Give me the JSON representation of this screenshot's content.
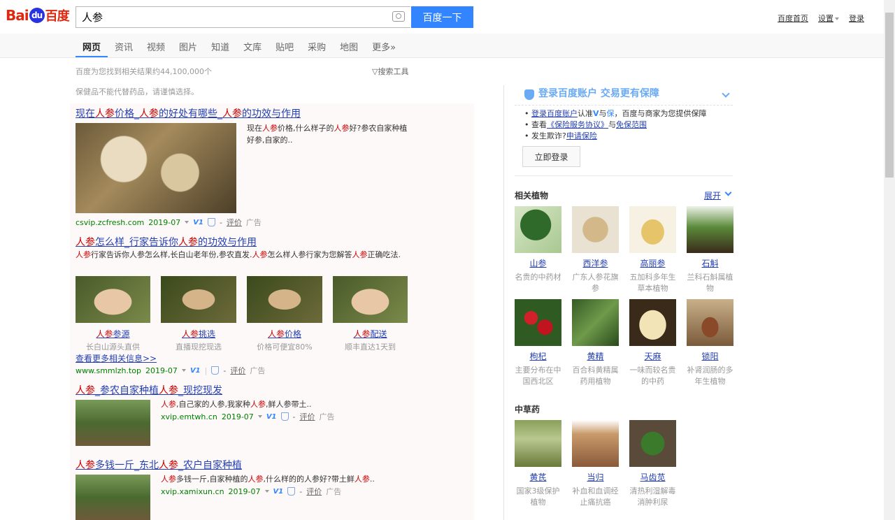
{
  "header": {
    "logo_bai": "Bai",
    "logo_du": "du",
    "logo_cn": "百度",
    "search_value": "人参",
    "search_button": "百度一下",
    "links": [
      "百度首页",
      "设置",
      "登录"
    ]
  },
  "tabs": [
    "网页",
    "资讯",
    "视频",
    "图片",
    "知道",
    "文库",
    "贴吧",
    "采购",
    "地图",
    "更多»"
  ],
  "result_count": "百度为您找到相关结果约44,100,000个",
  "search_tools": "搜索工具",
  "notice": "保健品不能代替药品，请谨慎选择。",
  "results": [
    {
      "title_parts": [
        [
          "现在",
          ""
        ],
        [
          "人参",
          "hl"
        ],
        [
          "价格_",
          ""
        ],
        [
          "人参",
          "hl"
        ],
        [
          "的好处有哪些_",
          ""
        ],
        [
          "人参",
          "hl"
        ],
        [
          "的功效与作用",
          ""
        ]
      ],
      "desc_parts": [
        [
          "现在",
          ""
        ],
        [
          "人参",
          "hl"
        ],
        [
          "价格,什么样子的",
          ""
        ],
        [
          "人参",
          "hl"
        ],
        [
          "好?参农自家种植好参,自家的..",
          ""
        ]
      ],
      "url": "csvip.zcfresh.com",
      "date": "2019-07",
      "review": "评价",
      "ad": "广告"
    },
    {
      "title_parts": [
        [
          "人参",
          "hl"
        ],
        [
          "怎么样_行家告诉你",
          ""
        ],
        [
          "人参",
          "hl"
        ],
        [
          "的功效与作用",
          ""
        ]
      ],
      "desc_parts": [
        [
          "人参",
          "hl"
        ],
        [
          "行家告诉你人参怎么样,长白山老年份,参农直发.",
          ""
        ],
        [
          "人参",
          "hl"
        ],
        [
          "怎么样人参行家为您解答",
          ""
        ],
        [
          "人参",
          "hl"
        ],
        [
          "正确吃法.",
          ""
        ]
      ],
      "sublinks": [
        {
          "title_hl": "人参",
          "title": "参源",
          "desc": "长白山源头直供"
        },
        {
          "title_hl": "人参",
          "title": "挑选",
          "desc": "直播现挖现选"
        },
        {
          "title_hl": "人参",
          "title": "价格",
          "desc": "价格可便宜80%"
        },
        {
          "title_hl": "人参",
          "title": "配送",
          "desc": "顺丰直达1天到"
        }
      ],
      "more": "查看更多相关信息>>",
      "url": "www.smmlzh.top",
      "date": "2019-07",
      "review": "评价",
      "ad": "广告"
    },
    {
      "title_parts": [
        [
          "人参",
          "hl"
        ],
        [
          "_参农自家种植",
          ""
        ],
        [
          "人参",
          "hl"
        ],
        [
          "_现挖现发",
          ""
        ]
      ],
      "desc_parts": [
        [
          "人参",
          "hl"
        ],
        [
          ",自己家的人参,我家种",
          ""
        ],
        [
          "人参",
          "hl"
        ],
        [
          ",鲜人参带土..",
          ""
        ]
      ],
      "url": "xvip.emtwh.cn",
      "date": "2019-07",
      "review": "评价",
      "ad": "广告"
    },
    {
      "title_parts": [
        [
          "人参",
          "hl"
        ],
        [
          "多钱一斤_东北",
          ""
        ],
        [
          "人参",
          "hl"
        ],
        [
          "_农户自家种植",
          ""
        ]
      ],
      "desc_parts": [
        [
          "人参",
          "hl"
        ],
        [
          "多钱一斤,自家种植的",
          ""
        ],
        [
          "人参",
          "hl"
        ],
        [
          ",什么样的的人参好?带土鲜",
          ""
        ],
        [
          "人参",
          "hl"
        ],
        [
          "..",
          ""
        ]
      ],
      "url": "xvip.xamixun.cn",
      "date": "2019-07",
      "review": "评价",
      "ad": "广告"
    }
  ],
  "login_box": {
    "title": "登录百度账户 交易更有保障",
    "line1_link": "登录百度账户",
    "line1_rest": "认准",
    "line1_v": "V",
    "line1_and": "与",
    "line1_bao": "保",
    "line1_tail": "，百度与商家为您提供保障",
    "line2_pre": "查看",
    "line2_link1": "《保险服务协议》",
    "line2_and": "与",
    "line2_link2": "免保范围",
    "line3_pre": "发生欺诈?",
    "line3_link": "申请保险",
    "button": "立即登录"
  },
  "related_plants": {
    "title": "相关植物",
    "expand": "展开",
    "items": [
      {
        "name": "山参",
        "desc": "名贵的中药材"
      },
      {
        "name": "西洋参",
        "desc": "广东人参花旗参"
      },
      {
        "name": "高丽参",
        "desc": "五加科多年生草本植物"
      },
      {
        "name": "石斛",
        "desc": "兰科石斛属植物"
      },
      {
        "name": "枸杞",
        "desc": "主要分布在中国西北区"
      },
      {
        "name": "黄精",
        "desc": "百合科黄精属药用植物"
      },
      {
        "name": "天麻",
        "desc": "一味而较名贵的中药"
      },
      {
        "name": "锁阳",
        "desc": "补肾润肠的多年生植物"
      }
    ]
  },
  "herbs": {
    "title": "中草药",
    "items": [
      {
        "name": "黄芪",
        "desc": "国家3级保护植物"
      },
      {
        "name": "当归",
        "desc": "补血和血调经止痛抗癌"
      },
      {
        "name": "马齿苋",
        "desc": "清热利湿解毒消肿利尿"
      }
    ]
  }
}
